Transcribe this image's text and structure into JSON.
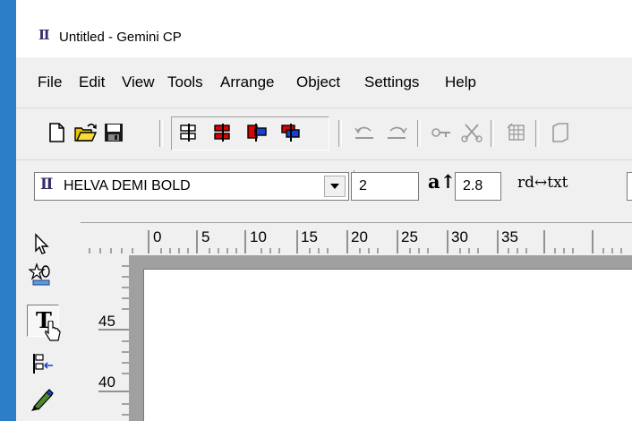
{
  "window": {
    "app_icon": "Ⅱ",
    "title": "Untitled - Gemini CP"
  },
  "menu": [
    "File",
    "Edit",
    "View",
    "Tools",
    "Arrange",
    "Object",
    "Settings",
    "Help"
  ],
  "toolbar": {
    "icons": [
      "new-document-icon",
      "open-folder-icon",
      "save-icon",
      "align-left-icon",
      "align-center-icon",
      "align-right-icon",
      "align-right-alt-icon",
      "undo-icon",
      "redo-icon",
      "link-icon",
      "cut-icon",
      "grid-icon",
      "frame-icon"
    ]
  },
  "fontbar": {
    "font_icon": "Ⅱ",
    "font_name": "HELVA DEMI BOLD",
    "size_value": "2",
    "leading_label": "a↑",
    "leading_value": "2.8",
    "spacing_label": "rd↔txt"
  },
  "tools": [
    "pointer-icon",
    "star-shape-icon",
    "text-tool-icon",
    "align-tool-icon",
    "pen-tool-icon"
  ],
  "tool_labels": {
    "text": "T"
  },
  "ruler": {
    "horizontal": [
      "0",
      "5",
      "10",
      "15",
      "20",
      "25",
      "30",
      "35"
    ],
    "vertical": [
      "45",
      "40"
    ]
  }
}
